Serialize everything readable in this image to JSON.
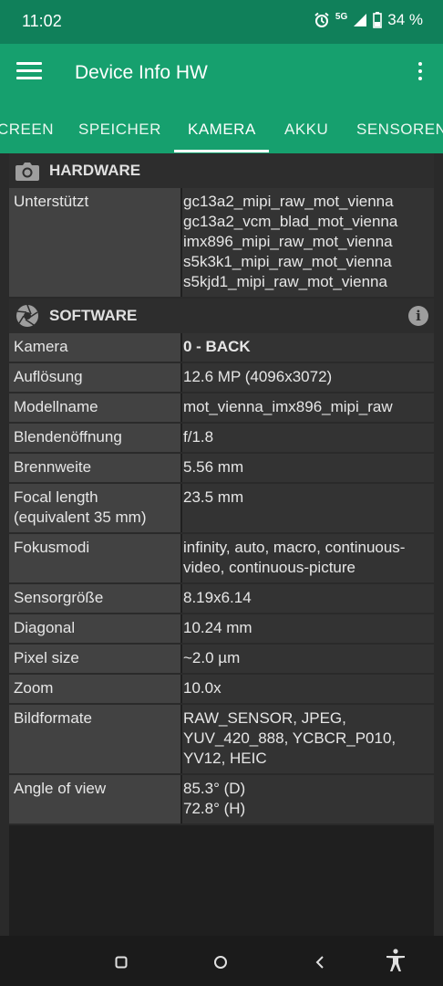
{
  "status": {
    "time": "11:02",
    "network": "5G",
    "battery": "34 %"
  },
  "appbar": {
    "title": "Device Info HW",
    "menu_icon": "hamburger-menu-icon",
    "more_icon": "more-vert-icon"
  },
  "tabs": [
    {
      "label": "CREEN"
    },
    {
      "label": "SPEICHER"
    },
    {
      "label": "KAMERA"
    },
    {
      "label": "AKKU"
    },
    {
      "label": "SENSOREN"
    }
  ],
  "hardware": {
    "header": "HARDWARE",
    "rows": [
      {
        "k": "Unterstützt",
        "v": "gc13a2_mipi_raw_mot_vienna\ngc13a2_vcm_blad_mot_vienna\nimx896_mipi_raw_mot_vienna\ns5k3k1_mipi_raw_mot_vienna\ns5kjd1_mipi_raw_mot_vienna"
      }
    ]
  },
  "software": {
    "header": "SOFTWARE",
    "info": "i",
    "rows": [
      {
        "k": "Kamera",
        "v": "0 - BACK"
      },
      {
        "k": "Auflösung",
        "v": "12.6 MP (4096x3072)"
      },
      {
        "k": "Modellname",
        "v": "mot_vienna_imx896_mipi_raw"
      },
      {
        "k": "Blendenöffnung",
        "v": "f/1.8"
      },
      {
        "k": "Brennweite",
        "v": "5.56 mm"
      },
      {
        "k": "Focal length (equivalent 35 mm)",
        "v": "23.5 mm"
      },
      {
        "k": "Fokusmodi",
        "v": "infinity, auto, macro, continuous-video, continuous-picture"
      },
      {
        "k": "Sensorgröße",
        "v": "8.19x6.14"
      },
      {
        "k": "Diagonal",
        "v": "10.24 mm"
      },
      {
        "k": "Pixel size",
        "v": "~2.0 µm"
      },
      {
        "k": "Zoom",
        "v": "10.0x"
      },
      {
        "k": "Bildformate",
        "v": "RAW_SENSOR, JPEG, YUV_420_888, YCBCR_P010, YV12, HEIC"
      },
      {
        "k": "Angle of view",
        "v": "85.3° (D)\n72.8° (H)"
      }
    ]
  },
  "colors": {
    "statusbar": "#10805a",
    "appbar": "#16a06e"
  }
}
